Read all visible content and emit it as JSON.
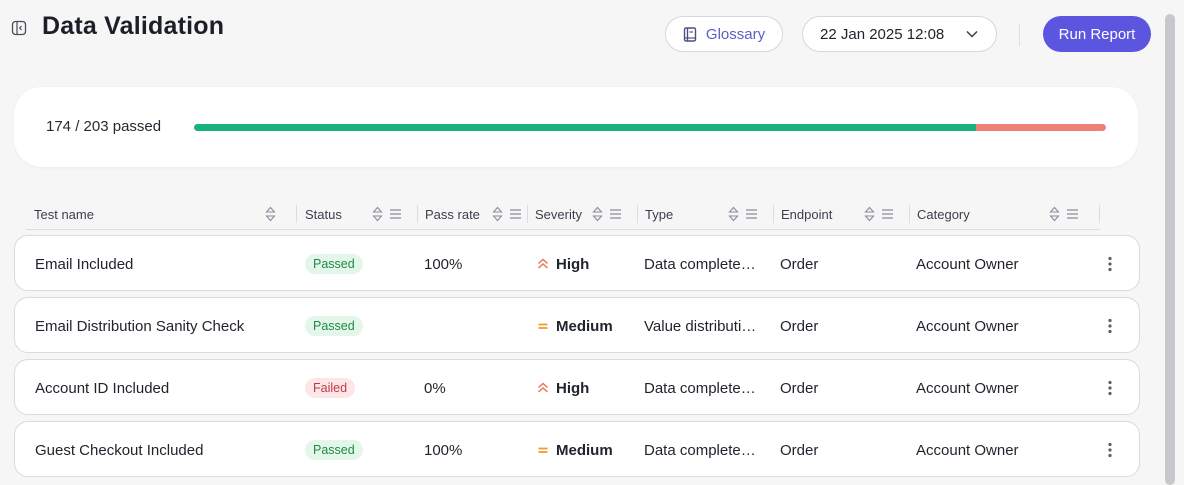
{
  "header": {
    "title": "Data Validation",
    "glossary_label": "Glossary",
    "date_value": "22 Jan 2025 12:08",
    "run_label": "Run Report"
  },
  "summary": {
    "text": "174 / 203 passed",
    "passed": 174,
    "total": 203
  },
  "colors": {
    "accent": "#5b55e0",
    "pass": "#19b27a",
    "fail": "#ef7f79",
    "sev_high": "#e8765a",
    "sev_medium": "#f09a2a"
  },
  "table": {
    "columns": [
      "Test name",
      "Status",
      "Pass rate",
      "Severity",
      "Type",
      "Endpoint",
      "Category"
    ],
    "rows": [
      {
        "name": "Email Included",
        "status": "Passed",
        "pass_rate": "100%",
        "severity": "High",
        "severity_icon": "chevrons-up-icon",
        "type": "Data complete…",
        "endpoint": "Order",
        "category": "Account Owner"
      },
      {
        "name": "Email Distribution Sanity Check",
        "status": "Passed",
        "pass_rate": "",
        "severity": "Medium",
        "severity_icon": "equals-icon",
        "type": "Value distributi…",
        "endpoint": "Order",
        "category": "Account Owner"
      },
      {
        "name": "Account ID Included",
        "status": "Failed",
        "pass_rate": "0%",
        "severity": "High",
        "severity_icon": "chevrons-up-icon",
        "type": "Data complete…",
        "endpoint": "Order",
        "category": "Account Owner"
      },
      {
        "name": "Guest Checkout Included",
        "status": "Passed",
        "pass_rate": "100%",
        "severity": "Medium",
        "severity_icon": "equals-icon",
        "type": "Data complete…",
        "endpoint": "Order",
        "category": "Account Owner"
      }
    ]
  }
}
